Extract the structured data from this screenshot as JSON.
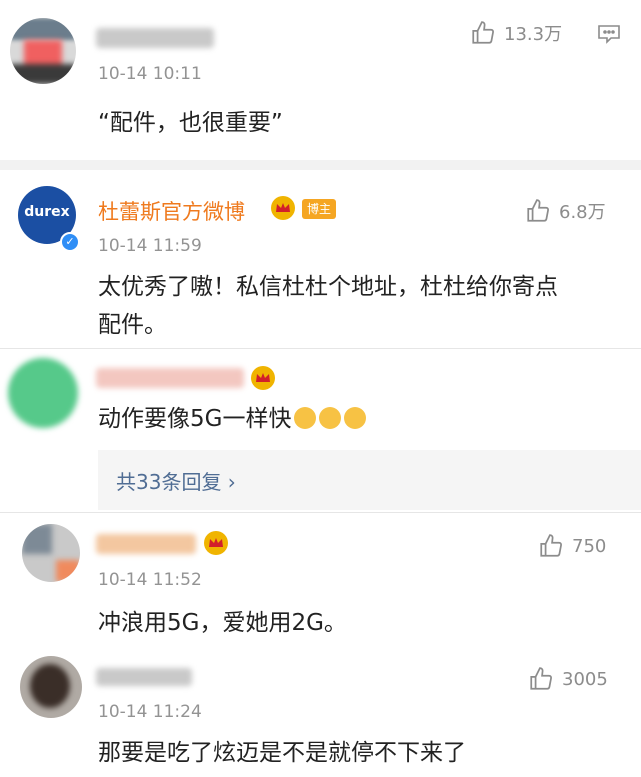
{
  "comments": [
    {
      "time": "10-14 10:11",
      "like_count": "13.3万",
      "text": "“配件，也很重要”"
    },
    {
      "user": "杜蕾斯官方微博",
      "badge": "博主",
      "avatar_text": "durex",
      "time": "10-14 11:59",
      "like_count": "6.8万",
      "text_line1": "太优秀了嗷！私信杜杜个地址，杜杜给你寄点",
      "text_line2": "配件。"
    },
    {
      "text": "动作要像5G一样快",
      "replies_label": "共33条回复 ›"
    },
    {
      "time": "10-14 11:52",
      "like_count": "750",
      "text": "冲浪用5G，爱她用2G。"
    },
    {
      "time": "10-14 11:24",
      "like_count": "3005",
      "text": "那要是吃了炫迈是不是就停不下来了"
    }
  ],
  "colors": {
    "brand_orange": "#ef7a1e",
    "reply_link": "#506d94",
    "badge": "#f5a623"
  }
}
